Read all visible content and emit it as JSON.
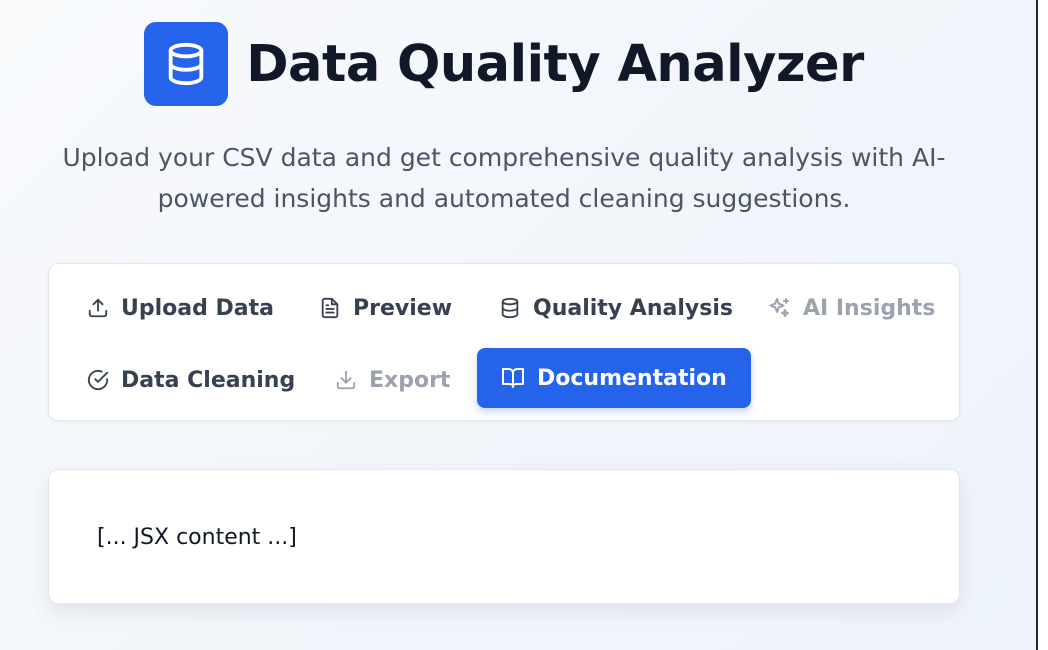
{
  "header": {
    "title": "Data Quality Analyzer",
    "subtitle_line1": "Upload your CSV data and get comprehensive quality analysis with AI-",
    "subtitle_line2": "powered insights and automated cleaning suggestions.",
    "logo_icon": "database-icon"
  },
  "colors": {
    "accent": "#2563eb",
    "title": "#111827",
    "subtitle": "#4b5563",
    "tab_text": "#374151",
    "tab_disabled": "#9ca3af"
  },
  "tabs": [
    {
      "label": "Upload Data",
      "icon": "upload-icon",
      "state": "enabled"
    },
    {
      "label": "Preview",
      "icon": "file-text-icon",
      "state": "enabled"
    },
    {
      "label": "Quality Analysis",
      "icon": "database-icon",
      "state": "enabled"
    },
    {
      "label": "AI Insights",
      "icon": "sparkles-icon",
      "state": "disabled"
    },
    {
      "label": "Data Cleaning",
      "icon": "check-circle-icon",
      "state": "enabled"
    },
    {
      "label": "Export",
      "icon": "download-icon",
      "state": "disabled"
    },
    {
      "label": "Documentation",
      "icon": "book-open-icon",
      "state": "active"
    }
  ],
  "content": {
    "text": "[... JSX content ...]"
  }
}
